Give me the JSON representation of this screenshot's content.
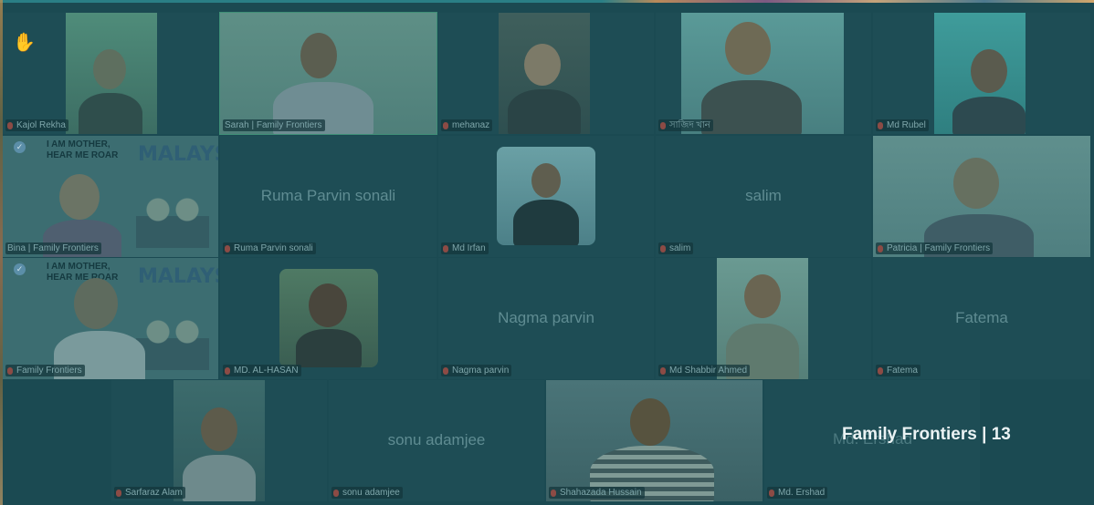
{
  "branding": {
    "text": "Family Frontiers | 13"
  },
  "poster": {
    "line1": "I AM MOTHER,",
    "line2": "HEAR ME ROAR",
    "headline": "MALAYSIA"
  },
  "participants": [
    {
      "id": "kajol",
      "label": "Kajol Rekha",
      "raised_hand": true
    },
    {
      "id": "sarah",
      "label": "Sarah | Family Frontiers",
      "active_speaker": true
    },
    {
      "id": "mehanaz",
      "label": "mehanaz"
    },
    {
      "id": "sajid",
      "label": "সাজিদ খান"
    },
    {
      "id": "rubel",
      "label": "Md Rubel"
    },
    {
      "id": "bina",
      "label": "Bina | Family Frontiers"
    },
    {
      "id": "ruma",
      "label": "Ruma Parvin sonali",
      "display_name": "Ruma Parvin sonali"
    },
    {
      "id": "irfan",
      "label": "Md Irfan"
    },
    {
      "id": "salim",
      "label": "salim",
      "display_name": "salim"
    },
    {
      "id": "patricia",
      "label": "Patricia | Family Frontiers"
    },
    {
      "id": "ff",
      "label": "Family Frontiers"
    },
    {
      "id": "alhasan",
      "label": "MD. AL-HASAN"
    },
    {
      "id": "nagma",
      "label": "Nagma parvin",
      "display_name": "Nagma parvin"
    },
    {
      "id": "shabbir",
      "label": "Md Shabbir Ahmed"
    },
    {
      "id": "fatema",
      "label": "Fatema",
      "display_name": "Fatema"
    },
    {
      "id": "sarfaraz",
      "label": "Sarfaraz Alam"
    },
    {
      "id": "sonu",
      "label": "sonu adamjee",
      "display_name": "sonu  adamjee"
    },
    {
      "id": "shahazada",
      "label": "Shahazada Hussain"
    },
    {
      "id": "ershad",
      "label": "Md. Ershad",
      "display_name": "Md. Ershad"
    }
  ],
  "colors": {
    "background": "#1b4a52",
    "active_outline": "#3f8f77",
    "label_text": "#7fa7ab"
  }
}
